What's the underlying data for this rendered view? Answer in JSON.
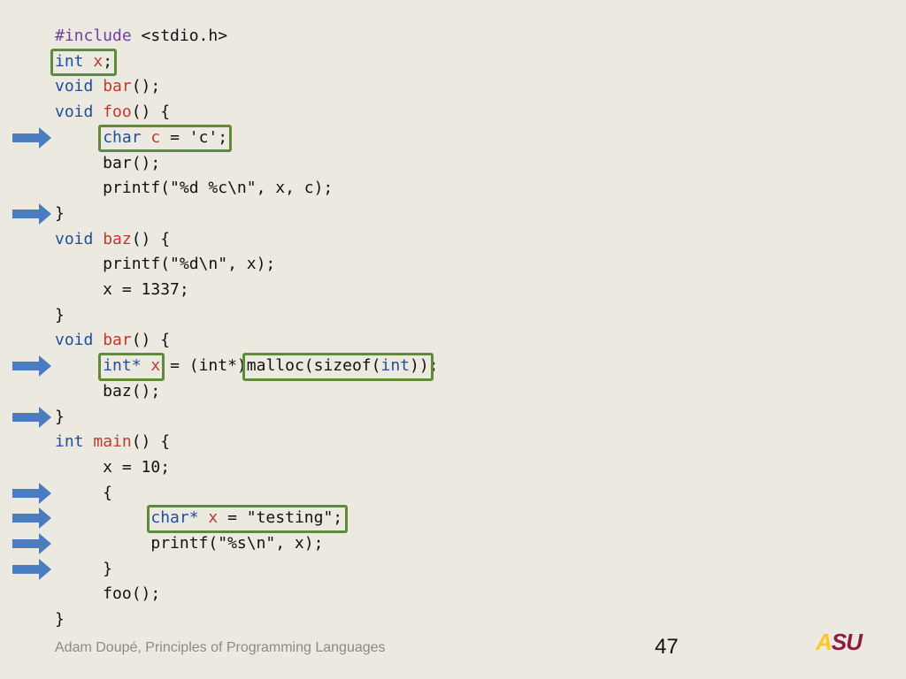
{
  "code_lines": [
    [
      {
        "t": "#include",
        "c": "pp"
      },
      {
        "t": " <stdio.h>"
      }
    ],
    [
      {
        "t": "int",
        "c": "kw"
      },
      {
        "t": " "
      },
      {
        "t": "x",
        "c": "id"
      },
      {
        "t": ";"
      }
    ],
    [
      {
        "t": "void",
        "c": "kw"
      },
      {
        "t": " "
      },
      {
        "t": "bar",
        "c": "id"
      },
      {
        "t": "();"
      }
    ],
    [
      {
        "t": "void",
        "c": "kw"
      },
      {
        "t": " "
      },
      {
        "t": "foo",
        "c": "id"
      },
      {
        "t": "() {"
      }
    ],
    [
      {
        "t": "     "
      },
      {
        "t": "char",
        "c": "kw"
      },
      {
        "t": " "
      },
      {
        "t": "c",
        "c": "id"
      },
      {
        "t": " = 'c';"
      }
    ],
    [
      {
        "t": "     bar();"
      }
    ],
    [
      {
        "t": "     printf(\"%d %c\\n\", x, c);"
      }
    ],
    [
      {
        "t": "}"
      }
    ],
    [
      {
        "t": "void",
        "c": "kw"
      },
      {
        "t": " "
      },
      {
        "t": "baz",
        "c": "id"
      },
      {
        "t": "() {"
      }
    ],
    [
      {
        "t": "     printf(\"%d\\n\", x);"
      }
    ],
    [
      {
        "t": "     x = 1337;"
      }
    ],
    [
      {
        "t": "}"
      }
    ],
    [
      {
        "t": "void",
        "c": "kw"
      },
      {
        "t": " "
      },
      {
        "t": "bar",
        "c": "id"
      },
      {
        "t": "() {"
      }
    ],
    [
      {
        "t": "     "
      },
      {
        "t": "int*",
        "c": "kw"
      },
      {
        "t": " "
      },
      {
        "t": "x",
        "c": "id"
      },
      {
        "t": " = (int*)malloc(sizeof("
      },
      {
        "t": "int",
        "c": "kw"
      },
      {
        "t": "));"
      }
    ],
    [
      {
        "t": "     baz();"
      }
    ],
    [
      {
        "t": "}"
      }
    ],
    [
      {
        "t": "int",
        "c": "kw"
      },
      {
        "t": " "
      },
      {
        "t": "main",
        "c": "id"
      },
      {
        "t": "() {"
      }
    ],
    [
      {
        "t": "     x = 10;"
      }
    ],
    [
      {
        "t": "     {"
      }
    ],
    [
      {
        "t": "          "
      },
      {
        "t": "char*",
        "c": "kw"
      },
      {
        "t": " "
      },
      {
        "t": "x",
        "c": "id"
      },
      {
        "t": " = \"testing\";"
      }
    ],
    [
      {
        "t": "          printf(\"%s\\n\", x);"
      }
    ],
    [
      {
        "t": "     }"
      }
    ],
    [
      {
        "t": "     foo();"
      }
    ],
    [
      {
        "t": "}"
      }
    ]
  ],
  "highlight_boxes": [
    {
      "line": 1,
      "text": "int x;"
    },
    {
      "line": 4,
      "text": "char c = 'c';"
    },
    {
      "line": 13,
      "text": "int* x"
    },
    {
      "line": 13,
      "text": "malloc(sizeof(int))"
    },
    {
      "line": 19,
      "text": "char* x = \"testing\";"
    }
  ],
  "arrow_lines": [
    4,
    7,
    13,
    15,
    18,
    19,
    20,
    21
  ],
  "footer": {
    "author": "Adam Doupé, Principles of Programming Languages",
    "page_number": "47",
    "logo_text": "ASU"
  },
  "colors": {
    "background": "#ECE9E0",
    "keyword": "#1F4E9A",
    "identifier": "#C0392B",
    "preprocessor": "#6F3FA0",
    "box_border": "#5E8A3A",
    "arrow": "#4A7CC0"
  }
}
